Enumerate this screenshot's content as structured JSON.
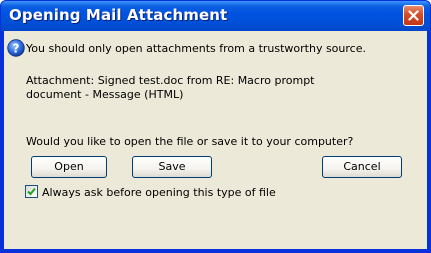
{
  "window": {
    "title": "Opening Mail Attachment"
  },
  "dialog": {
    "icon": "question-icon",
    "warning": "You should only open attachments from a trustworthy source.",
    "attachment_line1": "Attachment: Signed test.doc from RE: Macro prompt",
    "attachment_line2": "document - Message (HTML)",
    "question": "Would you like to open the file or save it to your computer?"
  },
  "buttons": {
    "open_label": "Open",
    "save_label": "Save",
    "cancel_label": "Cancel"
  },
  "checkbox": {
    "label": "Always ask before opening this type of file",
    "checked": true
  },
  "colors": {
    "titlebar": "#0054e3",
    "close": "#d44d24",
    "dialog_bg": "#ece9d8",
    "check": "#21a121"
  }
}
